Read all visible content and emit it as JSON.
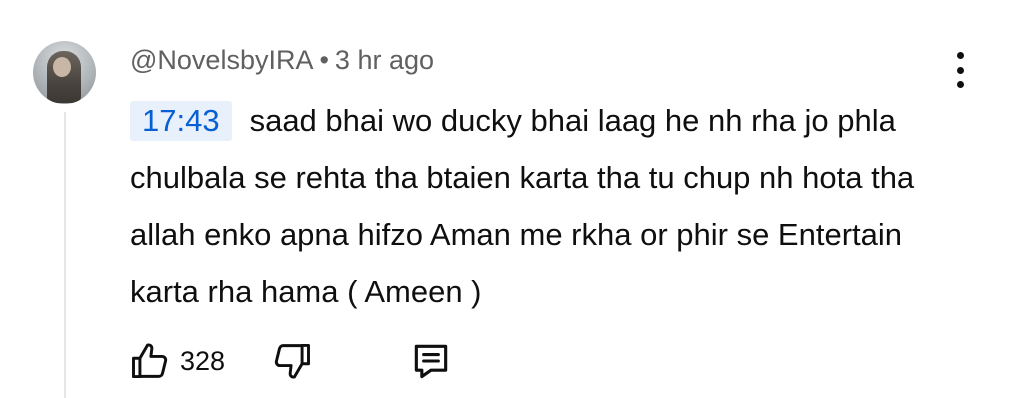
{
  "comment": {
    "author": "@NovelsbyIRA",
    "separator": "•",
    "time": "3 hr ago",
    "timestamp_link": "17:43",
    "text": "saad bhai wo ducky bhai laag he nh rha jo phla chulbala se rehta tha btaien karta tha tu chup nh hota tha allah enko apna hifzo Aman me rkha or phir se Entertain karta rha hama ( Ameen )",
    "like_count": "328"
  },
  "icons": {
    "like": "thumbs-up-icon",
    "dislike": "thumbs-down-icon",
    "reply": "comment-icon",
    "more": "more-vertical-icon"
  },
  "colors": {
    "timestamp_text": "#065fd4",
    "timestamp_bg": "#e8f0fb",
    "meta": "#606060",
    "text": "#0f0f0f"
  }
}
